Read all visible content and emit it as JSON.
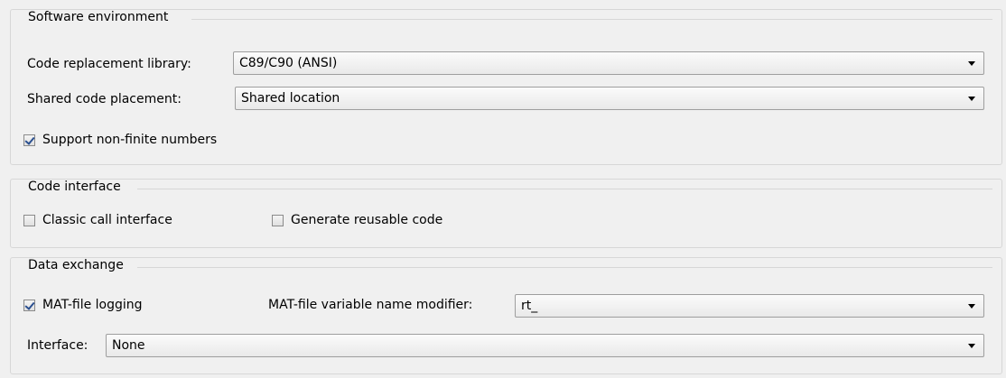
{
  "software_environment": {
    "title": "Software environment",
    "code_replacement_library": {
      "label": "Code replacement library:",
      "value": "C89/C90 (ANSI)"
    },
    "shared_code_placement": {
      "label": "Shared code placement:",
      "value": "Shared location"
    },
    "support_non_finite": {
      "label": "Support non-finite numbers",
      "checked": true
    }
  },
  "code_interface": {
    "title": "Code interface",
    "classic_call_interface": {
      "label": "Classic call interface",
      "checked": false
    },
    "generate_reusable_code": {
      "label": "Generate reusable code",
      "checked": false
    }
  },
  "data_exchange": {
    "title": "Data exchange",
    "mat_file_logging": {
      "label": "MAT-file logging",
      "checked": true
    },
    "mat_file_modifier": {
      "label": "MAT-file variable name modifier:",
      "value": "rt_"
    },
    "interface": {
      "label": "Interface:",
      "value": "None"
    }
  },
  "icons": {
    "dropdown": "chevron-down-icon",
    "checkmark": "checkmark-icon"
  }
}
